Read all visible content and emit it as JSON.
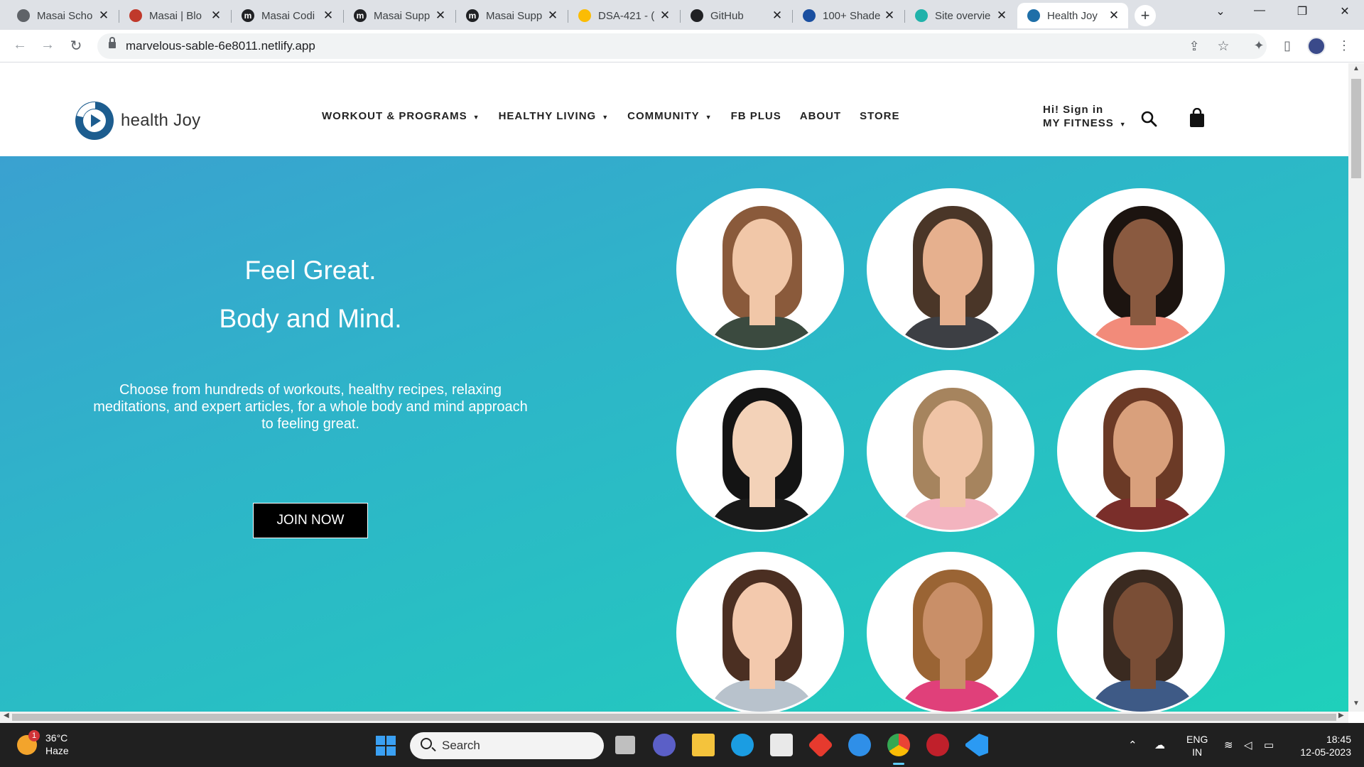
{
  "browser": {
    "tabs": [
      {
        "title": "Masai Scho",
        "color": "#5f6368",
        "glyph": ""
      },
      {
        "title": "Masai | Blo",
        "color": "#c0392b",
        "glyph": ""
      },
      {
        "title": "Masai Codi",
        "color": "#202124",
        "glyph": "m"
      },
      {
        "title": "Masai Supp",
        "color": "#202124",
        "glyph": "m"
      },
      {
        "title": "Masai Supp",
        "color": "#202124",
        "glyph": "m"
      },
      {
        "title": "DSA-421 - (",
        "color": "#fbbc04",
        "glyph": ""
      },
      {
        "title": "GitHub",
        "color": "#202124",
        "glyph": ""
      },
      {
        "title": "100+ Shade",
        "color": "#1a4fa0",
        "glyph": ""
      },
      {
        "title": "Site overvie",
        "color": "#20b2aa",
        "glyph": ""
      },
      {
        "title": "Health Joy",
        "color": "#1f6fa8",
        "glyph": ""
      }
    ],
    "close_glyph": "✕",
    "new_tab_glyph": "+",
    "url": "marvelous-sable-6e8011.netlify.app"
  },
  "site": {
    "logo_text": "health Joy",
    "nav": [
      {
        "label": "WORKOUT & PROGRAMS",
        "caret": "▼"
      },
      {
        "label": "HEALTHY LIVING",
        "caret": "▼"
      },
      {
        "label": "COMMUNITY",
        "caret": "▼"
      },
      {
        "label": "FB PLUS",
        "caret": ""
      },
      {
        "label": "ABOUT",
        "caret": ""
      },
      {
        "label": "STORE",
        "caret": ""
      }
    ],
    "signin_line1": "Hi! Sign in",
    "signin_line2": "MY FITNESS",
    "signin_caret": "▼"
  },
  "hero": {
    "heading1": "Feel Great.",
    "heading2": "Body and Mind.",
    "paragraph": "Choose from hundreds of workouts, healthy recipes, relaxing meditations, and expert articles, for a whole body and mind approach to feeling great.",
    "cta": "JOIN NOW"
  },
  "trainers": [
    {
      "hair": "#8a5a3b",
      "skin": "#f1c7a8",
      "shirt": "#3b4a3f"
    },
    {
      "hair": "#4a3628",
      "skin": "#e6b08e",
      "shirt": "#3d3f44"
    },
    {
      "hair": "#1c1410",
      "skin": "#8a5a40",
      "shirt": "#f28b7a"
    },
    {
      "hair": "#141414",
      "skin": "#f3d2b8",
      "shirt": "#1a1a1a"
    },
    {
      "hair": "#a6845e",
      "skin": "#f0c4a6",
      "shirt": "#f3b4bf"
    },
    {
      "hair": "#6b3a26",
      "skin": "#d9a07c",
      "shirt": "#7a2e2a"
    },
    {
      "hair": "#4b2f22",
      "skin": "#f3c9ad",
      "shirt": "#b8c2cc"
    },
    {
      "hair": "#9a6434",
      "skin": "#c98f68",
      "shirt": "#e0407a"
    },
    {
      "hair": "#3a2a20",
      "skin": "#7a4e36",
      "shirt": "#3e5a86"
    }
  ],
  "taskbar": {
    "temperature": "36°C",
    "weather": "Haze",
    "weather_badge": "1",
    "search_placeholder": "Search",
    "lang1": "ENG",
    "lang2": "IN",
    "time": "18:45",
    "date": "12-05-2023"
  }
}
